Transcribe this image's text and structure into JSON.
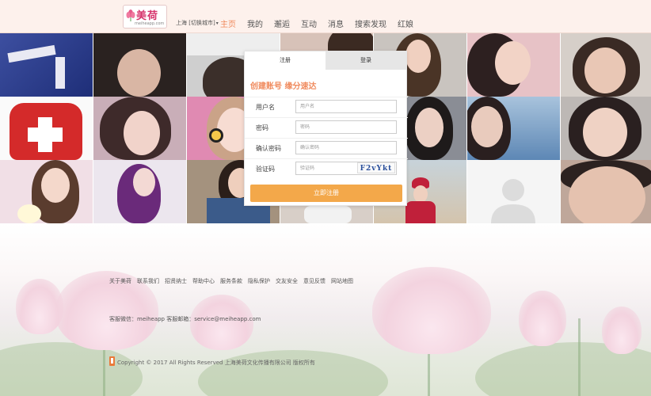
{
  "header": {
    "logo_text": "美荷",
    "logo_domain": "meiheapp.com",
    "city": "上海 [切换城市]",
    "nav": [
      {
        "label": "主页",
        "active": true
      },
      {
        "label": "我的",
        "active": false
      },
      {
        "label": "邂逅",
        "active": false
      },
      {
        "label": "互动",
        "active": false
      },
      {
        "label": "消息",
        "active": false
      },
      {
        "label": "搜索发现",
        "active": false
      },
      {
        "label": "红娘",
        "active": false
      }
    ]
  },
  "register": {
    "tab_register": "注册",
    "tab_login": "登录",
    "slogan": "创建账号 缘分速达",
    "fields": [
      {
        "label": "用户名",
        "placeholder": "用户名"
      },
      {
        "label": "密码",
        "placeholder": "密码"
      },
      {
        "label": "确认密码",
        "placeholder": "确认密码"
      },
      {
        "label": "验证码",
        "placeholder": "验证码"
      }
    ],
    "captcha": "F2vYkt",
    "submit": "立即注册"
  },
  "footer": {
    "links": [
      "关于美荷",
      "联系我们",
      "招贤纳士",
      "帮助中心",
      "服务条款",
      "隐私保护",
      "交友安全",
      "意见反馈",
      "网站地图"
    ],
    "service": "客服微信：meiheapp 客服邮箱：service@meiheapp.com",
    "copyright": "Copyright © 2017 All Rights Reserved 上海美荷文化传播有限公司 版权所有"
  },
  "colors": {
    "accent": "#f08a5d",
    "button": "#f3a84a",
    "header_bg": "#fdf1ec"
  }
}
